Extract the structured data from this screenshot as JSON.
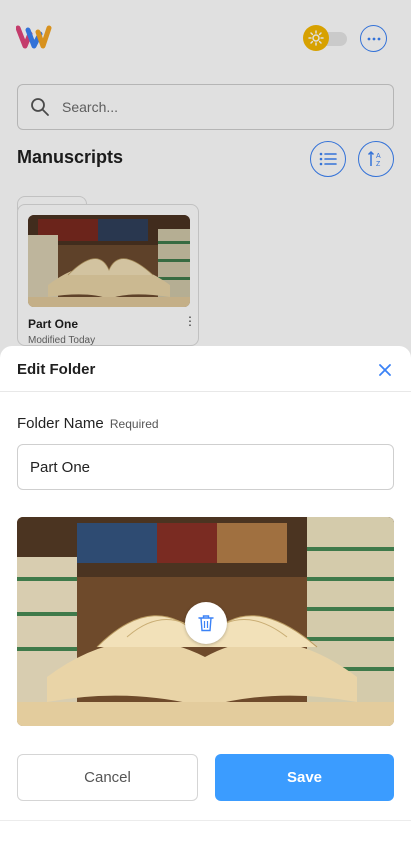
{
  "app": {
    "search_placeholder": "Search...",
    "section_title": "Manuscripts",
    "folders": [
      {
        "name": "Part One",
        "modified": "Modified Today"
      }
    ]
  },
  "dialog": {
    "title": "Edit Folder",
    "field_label": "Folder Name",
    "field_required": "Required",
    "field_value": "Part One",
    "cancel_label": "Cancel",
    "save_label": "Save"
  },
  "colors": {
    "accent": "#3b82f6",
    "save_button": "#3b9cff",
    "toggle_knob": "#f5b800"
  },
  "icons": [
    "app-logo-icon",
    "sun-icon",
    "more-icon",
    "search-icon",
    "list-view-icon",
    "sort-az-icon",
    "kebab-menu-icon",
    "close-icon",
    "trash-icon"
  ]
}
